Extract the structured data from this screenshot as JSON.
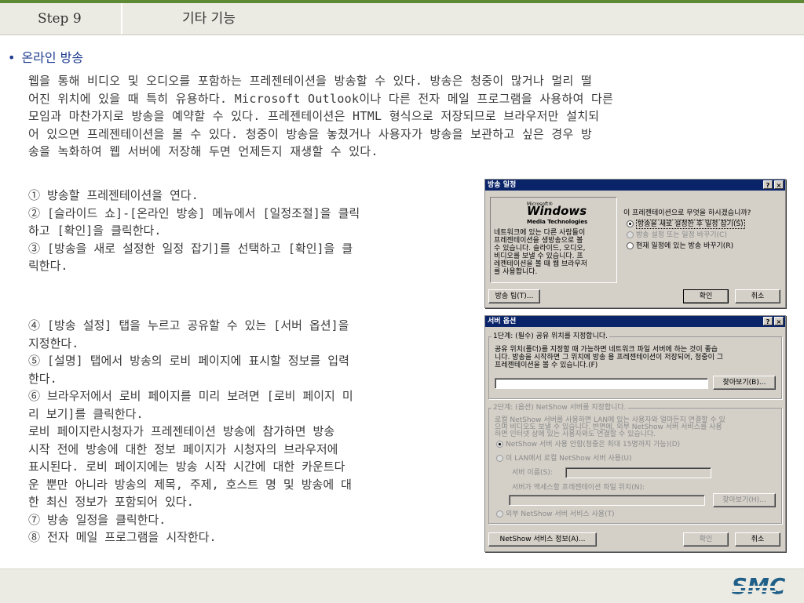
{
  "header": {
    "step": "Step 9",
    "title": "기타 기능"
  },
  "section": {
    "bullet": "•",
    "title": "온라인 방송"
  },
  "intro": [
    "웹을 통해 비디오 및 오디오를 포함하는 프레젠테이션을 방송할 수 있다. 방송은 청중이 많거나 멀리 떨",
    "어진 위치에 있을 때 특히 유용하다. Microsoft Outlook이나 다른 전자 메일 프로그램을 사용하여 다른",
    "모임과 마찬가지로 방송을 예약할 수 있다. 프레젠테이션은 HTML 형식으로 저장되므로 브라우저만 설치되",
    "어 있으면 프레젠테이션을 볼 수 있다. 청중이 방송을 놓쳤거나 사용자가 방송을 보관하고 싶은 경우 방",
    "송을 녹화하여 웹 서버에 저장해 두면 언제든지 재생할 수 있다."
  ],
  "steps1": [
    "① 방송할 프레젠테이션을 연다.",
    "② [슬라이드 쇼]-[온라인 방송] 메뉴에서 [일정조절]을 클릭",
    "하고 [확인]을 클릭한다.",
    "③ [방송을 새로 설정한 일정 잡기]를 선택하고 [확인]을 클",
    "릭한다."
  ],
  "steps2": [
    "④ [방송 설정] 탭을 누르고 공유할 수 있는 [서버 옵션]을",
    "지정한다.",
    "⑤ [설명] 탭에서 방송의 로비 페이지에 표시할 정보를 입력",
    "한다.",
    "⑥ 브라우저에서 로비 페이지를 미리 보려면 [로비 페이지 미",
    "리 보기]를 클릭한다.",
    "로비 페이지란시청자가 프레젠테이션 방송에 참가하면 방송",
    "시작 전에 방송에 대한 정보 페이지가 시청자의 브라우저에",
    "표시된다. 로비 페이지에는 방송 시작 시간에 대한 카운트다",
    "운 뿐만 아니라 방송의 제목, 주제, 호스트 명 및 방송에 대",
    "한 최신 정보가 포함되어 있다.",
    "⑦ 방송 일정을 클릭한다.",
    "⑧ 전자 메일 프로그램을 시작한다."
  ],
  "dialog1": {
    "title": "방송 일정",
    "help": "?",
    "close": "×",
    "logo_small": "Microsoft®",
    "logo_big": "Windows",
    "logo_sub": "Media Technologies",
    "desc": [
      "네트워크에 있는 다른 사람들이",
      "프레젠테이션을 생방송으로 볼",
      "수 있습니다. 슬라이드, 오디오,",
      "비디오를 보낼 수 있습니다. 프",
      "레젠테이션을 볼 때 웹 브라우저",
      "를 사용합니다."
    ],
    "question": "이 프레젠테이션으로 무엇을 하시겠습니까?",
    "options": [
      "방송을 새로 설정한 후 일정 잡기(S)",
      "방송 설정 또는 일정 바꾸기(C)",
      "현재 일정에 있는 방송 바꾸기(R)"
    ],
    "tips_button": "방송 팁(T)...",
    "ok_button": "확인",
    "cancel_button": "취소"
  },
  "dialog2": {
    "title": "서버 옵션",
    "help": "?",
    "close": "×",
    "step1_label": "1단계: (필수) 공유 위치를 지정합니다.",
    "step1_desc": [
      "공유 위치(폴더)를 지정할 때 가능하면 네트워크 파일 서버에 하는 것이 좋습",
      "니다. 방송을 시작하면 그 위치에 방송 용 프레젠테이션이 저장되어, 청중이 그",
      "프레젠테이션을 볼 수 있습니다.(F)"
    ],
    "browse1": "찾아보기(B)...",
    "step2_label": "2단계: (옵션) NetShow 서버를 지정합니다.",
    "step2_desc": [
      "로컬 NetShow 서버를 사용하면 LAN에 있는 사용자와 얼마든지 연결할 수 있",
      "으며 비디오도 보낼 수 있습니다. 반면에, 외부 NetShow 서버 서비스를 사용",
      "하면 인터넷 상에 있는 사용자와도 연결할 수 있습니다."
    ],
    "opt1": "NetShow 서버 사용 안함(청중은 최대 15명까지 가능)(D)",
    "opt2": "이 LAN에서 로컬 NetShow 서버 사용(U)",
    "server_name": "서버 이름(S):",
    "server_path": "서버가 액세스할 프레젠테이션 파일 위치(N):",
    "browse2": "찾아보기(H)...",
    "opt3": "외부 NetShow 서버 서비스 사용(T)",
    "info_button": "NetShow 서비스 정보(A)...",
    "ok_button": "확인",
    "cancel_button": "취소"
  },
  "footer": {
    "logo": "SMC"
  },
  "colors": {
    "green": "#5e8a35",
    "header_bg": "#ebebe3",
    "blue": "#1d3b8f",
    "titlebar": "#0a246a"
  }
}
